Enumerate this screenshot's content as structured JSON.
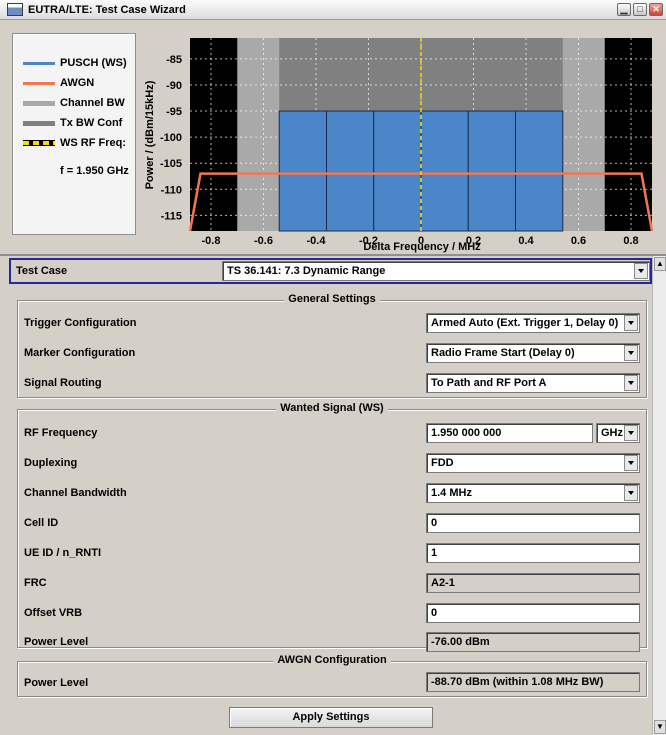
{
  "window": {
    "title": "EUTRA/LTE: Test Case Wizard"
  },
  "legend": {
    "items": [
      {
        "label": "PUSCH (WS)",
        "color": "#4a86c8"
      },
      {
        "label": "AWGN",
        "color": "#f07850"
      },
      {
        "label": "Channel BW",
        "color": "#a9a9a9"
      },
      {
        "label": "Tx BW Conf",
        "color": "#808080"
      },
      {
        "label": "WS RF Freq:",
        "color": "#ffd800"
      }
    ],
    "freq_label": "f = 1.950 GHz"
  },
  "chart_data": {
    "type": "area",
    "ylabel": "Power / (dBm/15kHz)",
    "xlabel": "Delta Frequency / MHz",
    "y_ticks": [
      "-85",
      "-90",
      "-95",
      "-100",
      "-105",
      "-110",
      "-115"
    ],
    "x_ticks": [
      "-0.8",
      "-0.6",
      "-0.4",
      "-0.2",
      "0",
      "0.2",
      "0.4",
      "0.6",
      "0.8"
    ],
    "xlim": [
      -0.88,
      0.88
    ],
    "ylim": [
      -118,
      -81
    ],
    "channel_bw": [
      -0.7,
      0.7
    ],
    "tx_bw_conf": [
      -0.54,
      0.54
    ],
    "ws_rf_freq": 0,
    "pusch": {
      "blocks": [
        [
          -0.54,
          -0.36
        ],
        [
          -0.36,
          -0.18
        ],
        [
          -0.18,
          0
        ],
        [
          0,
          0.18
        ],
        [
          0.18,
          0.36
        ],
        [
          0.36,
          0.54
        ]
      ],
      "level": -95
    },
    "awgn": {
      "points": [
        [
          -0.88,
          -118
        ],
        [
          -0.84,
          -107
        ],
        [
          0.84,
          -107
        ],
        [
          0.88,
          -118
        ]
      ]
    },
    "grid": true
  },
  "test_case": {
    "label": "Test Case",
    "value": "TS 36.141:  7.3   Dynamic Range"
  },
  "general": {
    "title": "General Settings",
    "trigger": {
      "label": "Trigger Configuration",
      "value": "Armed Auto (Ext. Trigger 1, Delay 0)"
    },
    "marker": {
      "label": "Marker Configuration",
      "value": "Radio Frame Start (Delay 0)"
    },
    "routing": {
      "label": "Signal Routing",
      "value": "To Path and RF Port A"
    }
  },
  "wanted": {
    "title": "Wanted Signal (WS)",
    "rf_freq": {
      "label": "RF Frequency",
      "value": "1.950 000 000",
      "unit": "GHz"
    },
    "duplexing": {
      "label": "Duplexing",
      "value": "FDD"
    },
    "channel_bw": {
      "label": "Channel Bandwidth",
      "value": "1.4 MHz"
    },
    "cell_id": {
      "label": "Cell ID",
      "value": "0"
    },
    "ue_id": {
      "label": "UE ID / n_RNTI",
      "value": "1"
    },
    "frc": {
      "label": "FRC",
      "value": "A2-1"
    },
    "offset_vrb": {
      "label": "Offset VRB",
      "value": "0"
    },
    "power_level": {
      "label": "Power Level",
      "value": "-76.00 dBm"
    }
  },
  "awgn": {
    "title": "AWGN Configuration",
    "power_level": {
      "label": "Power Level",
      "value": "-88.70 dBm (within 1.08 MHz BW)"
    }
  },
  "apply_label": "Apply Settings"
}
